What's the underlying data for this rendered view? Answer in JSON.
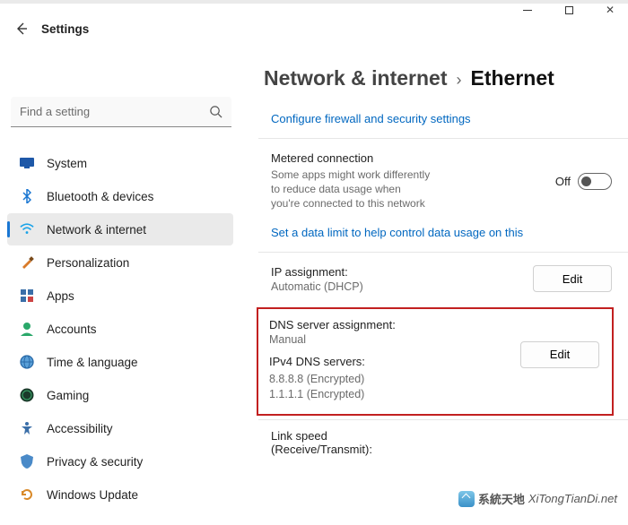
{
  "window": {
    "app_title": "Settings"
  },
  "search": {
    "placeholder": "Find a setting"
  },
  "sidebar": {
    "items": [
      {
        "label": "System",
        "icon": "system"
      },
      {
        "label": "Bluetooth & devices",
        "icon": "bluetooth"
      },
      {
        "label": "Network & internet",
        "icon": "wifi",
        "selected": true
      },
      {
        "label": "Personalization",
        "icon": "brush"
      },
      {
        "label": "Apps",
        "icon": "apps"
      },
      {
        "label": "Accounts",
        "icon": "person"
      },
      {
        "label": "Time & language",
        "icon": "globe"
      },
      {
        "label": "Gaming",
        "icon": "game"
      },
      {
        "label": "Accessibility",
        "icon": "accessibility"
      },
      {
        "label": "Privacy & security",
        "icon": "shield"
      },
      {
        "label": "Windows Update",
        "icon": "update"
      }
    ]
  },
  "breadcrumb": {
    "parent": "Network & internet",
    "current": "Ethernet"
  },
  "main": {
    "firewall_link": "Configure firewall and security settings",
    "metered": {
      "title": "Metered connection",
      "sub": "Some apps might work differently to reduce data usage when you're connected to this network",
      "state_label": "Off"
    },
    "data_limit_link": "Set a data limit to help control data usage on this",
    "ip": {
      "title": "IP assignment:",
      "value": "Automatic (DHCP)",
      "edit": "Edit"
    },
    "dns": {
      "title": "DNS server assignment:",
      "value": "Manual",
      "servers_label": "IPv4 DNS servers:",
      "servers": [
        "8.8.8.8 (Encrypted)",
        "1.1.1.1 (Encrypted)"
      ],
      "edit": "Edit"
    },
    "linkspeed": {
      "title": "Link speed (Receive/Transmit):"
    }
  },
  "watermark": {
    "main": "系統天地",
    "sub": "XiTongTianDi.net"
  }
}
